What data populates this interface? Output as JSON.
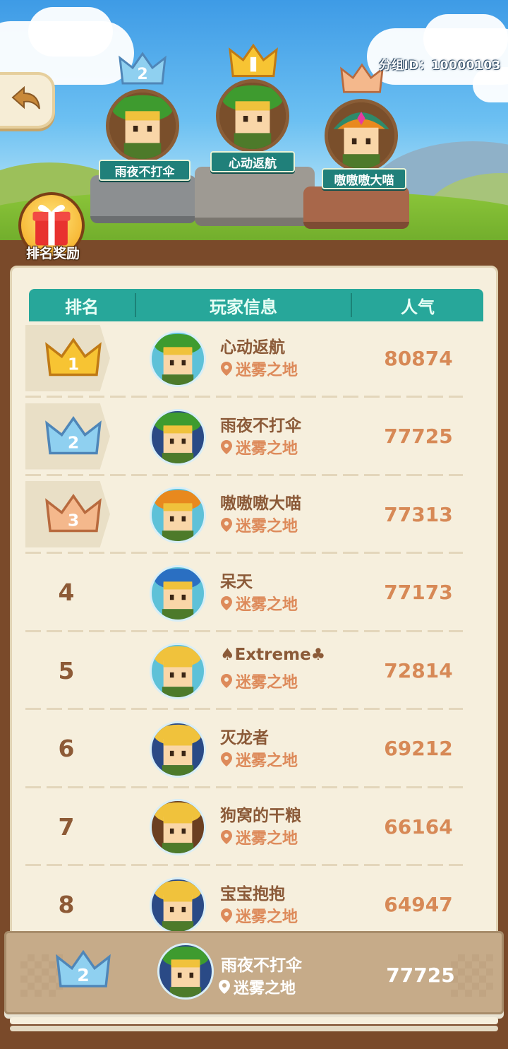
{
  "header": {
    "group_id": "分组ID：10000103",
    "back_icon": "back-arrow-icon"
  },
  "podium": [
    {
      "rank": 2,
      "name": "雨夜不打伞",
      "crown": "silver"
    },
    {
      "rank": 1,
      "name": "心动返航",
      "crown": "gold"
    },
    {
      "rank": 3,
      "name": "嗷嗷嗷大喵",
      "crown": "bronze"
    }
  ],
  "rewards": {
    "label": "排名奖励",
    "icon": "gift-box-icon"
  },
  "table": {
    "headers": {
      "rank": "排名",
      "player": "玩家信息",
      "popularity": "人气"
    },
    "rows": [
      {
        "rank": "1",
        "name": "心动返航",
        "location": "迷雾之地",
        "popularity": "80874",
        "crown": "gold"
      },
      {
        "rank": "2",
        "name": "雨夜不打伞",
        "location": "迷雾之地",
        "popularity": "77725",
        "crown": "silver"
      },
      {
        "rank": "3",
        "name": "嗷嗷嗷大喵",
        "location": "迷雾之地",
        "popularity": "77313",
        "crown": "bronze"
      },
      {
        "rank": "4",
        "name": "呆天",
        "location": "迷雾之地",
        "popularity": "77173"
      },
      {
        "rank": "5",
        "name": "♠Extreme♣",
        "location": "迷雾之地",
        "popularity": "72814"
      },
      {
        "rank": "6",
        "name": "灭龙者",
        "location": "迷雾之地",
        "popularity": "69212"
      },
      {
        "rank": "7",
        "name": "狗窝的干粮",
        "location": "迷雾之地",
        "popularity": "66164"
      },
      {
        "rank": "8",
        "name": "宝宝抱抱",
        "location": "迷雾之地",
        "popularity": "64947"
      }
    ]
  },
  "my_rank": {
    "rank": "2",
    "name": "雨夜不打伞",
    "location": "迷雾之地",
    "popularity": "77725",
    "crown": "silver"
  },
  "colors": {
    "teal_header": "#27a79a",
    "gold": "#f5b922",
    "silver": "#7fc4ea",
    "bronze": "#f0a06a",
    "name_brown": "#8b5a38",
    "pop_orange": "#d78956"
  }
}
